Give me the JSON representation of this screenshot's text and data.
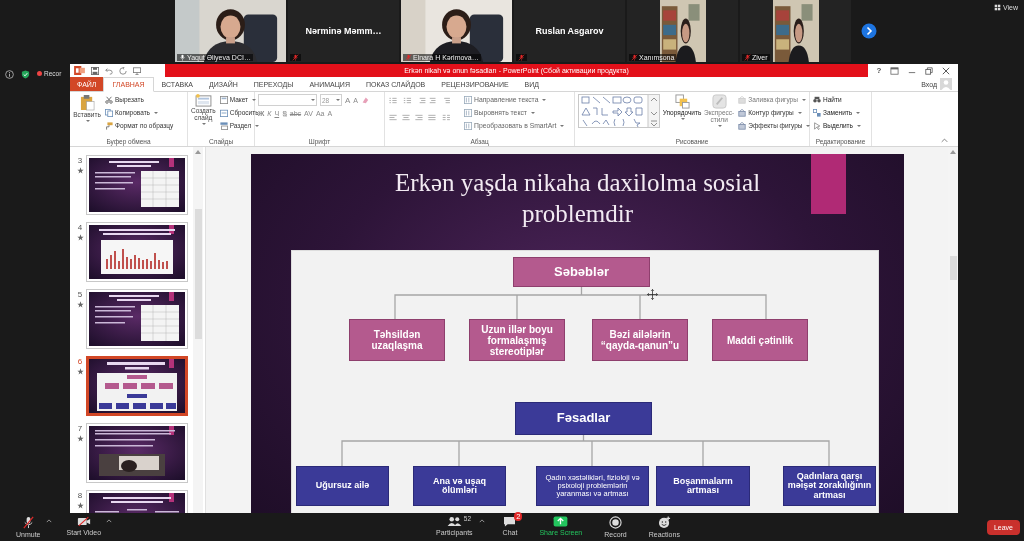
{
  "meeting": {
    "view_label": "View",
    "record_label": "Recor",
    "participants": [
      {
        "name": "Yaqut Əliyeva DCI…",
        "kind": "video",
        "muted": false
      },
      {
        "name": "Nərminə Məmm…",
        "kind": "name",
        "muted": true
      },
      {
        "name": "Elnara H Kərimova…",
        "kind": "video",
        "muted": true
      },
      {
        "name": "Ruslan Asgarov",
        "kind": "name",
        "muted": true
      },
      {
        "name": "Xanımsona",
        "kind": "portrait",
        "muted": true
      },
      {
        "name": "Ziver",
        "kind": "portrait",
        "muted": true
      }
    ]
  },
  "window": {
    "title": "Erkən nikah və onun fəsadları -  PowerPoint (Сбой активации продукта)",
    "help": "?"
  },
  "ribbon": {
    "tabs": [
      {
        "label": "ФАЙЛ",
        "kind": "file",
        "selected": false
      },
      {
        "label": "ГЛАВНАЯ",
        "kind": "tab",
        "selected": true
      },
      {
        "label": "ВСТАВКА",
        "kind": "tab",
        "selected": false
      },
      {
        "label": "ДИЗАЙН",
        "kind": "tab",
        "selected": false
      },
      {
        "label": "ПЕРЕХОДЫ",
        "kind": "tab",
        "selected": false
      },
      {
        "label": "АНИМАЦИЯ",
        "kind": "tab",
        "selected": false
      },
      {
        "label": "ПОКАЗ СЛАЙДОВ",
        "kind": "tab",
        "selected": false
      },
      {
        "label": "РЕЦЕНЗИРОВАНИЕ",
        "kind": "tab",
        "selected": false
      },
      {
        "label": "ВИД",
        "kind": "tab",
        "selected": false
      }
    ],
    "sign_in": "Вход",
    "clipboard": {
      "label": "Буфер обмена",
      "paste": "Вставить",
      "cut": "Вырезать",
      "copy": "Копировать",
      "format_painter": "Формат по образцу"
    },
    "slides": {
      "label": "Слайды",
      "new_slide": "Создать слайд",
      "layout": "Макет",
      "reset": "Сбросить",
      "section": "Раздел"
    },
    "font": {
      "label": "Шрифт",
      "size": "28",
      "size_buttons": [
        "A",
        "A"
      ],
      "buttons": [
        "Ж",
        "К",
        "Ч",
        "S",
        "abc",
        "AV",
        "Aa",
        "A"
      ]
    },
    "paragraph": {
      "label": "Абзац",
      "items": [
        "Направление текста",
        "Выровнять текст",
        "Преобразовать в SmartArt"
      ]
    },
    "drawing": {
      "label": "Рисование",
      "arrange": "Упорядочить",
      "quick_styles": "Экспресс-стили",
      "items": [
        {
          "label": "Заливка фигуры",
          "disabled": true
        },
        {
          "label": "Контур фигуры",
          "disabled": false
        },
        {
          "label": "Эффекты фигуры",
          "disabled": false
        }
      ]
    },
    "editing": {
      "label": "Редактирование",
      "items": [
        "Найти",
        "Заменить",
        "Выделить"
      ]
    }
  },
  "thumbnails": [
    {
      "number": "3",
      "kind": "table",
      "animated": true,
      "selected": false
    },
    {
      "number": "4",
      "kind": "chart",
      "animated": true,
      "selected": false
    },
    {
      "number": "5",
      "kind": "table",
      "animated": true,
      "selected": false
    },
    {
      "number": "6",
      "kind": "diagram",
      "animated": true,
      "selected": true
    },
    {
      "number": "7",
      "animated": true,
      "selected": false
    },
    {
      "number": "8",
      "kind": "columns",
      "animated": true,
      "selected": false
    }
  ],
  "slide": {
    "title": "Erkən yaşda nikaha daxilolma sosial problemdir",
    "causes_heading": "Səbəblər",
    "causes": [
      "Təhsildən uzaqlaşma",
      "Uzun illər boyu formalaşmış stereotiplər",
      "Bəzi ailələrin “qayda-qanun”u",
      "Maddi çətinlik"
    ],
    "effects_heading": "Fəsadlar",
    "effects": [
      "Uğursuz ailə",
      "Ana və uşaq ölümləri",
      "Qadın xəstəlikləri, fizioloji və psixoloji problemlərin yaranması və artması",
      "Boşanmaların artması",
      "Qadınlara qarşı məişət zorakılığının artması"
    ]
  },
  "zoom_bar": {
    "left": [
      {
        "label": "Unmute",
        "kind": "mic"
      },
      {
        "label": "Start Video",
        "kind": "camera"
      }
    ],
    "center": [
      {
        "label": "Participants",
        "kind": "participants",
        "count": "52"
      },
      {
        "label": "Chat",
        "kind": "chat",
        "badge": "2"
      },
      {
        "label": "Share Screen",
        "kind": "share"
      },
      {
        "label": "Record",
        "kind": "record"
      },
      {
        "label": "Reactions",
        "kind": "reactions"
      }
    ],
    "leave": "Leave"
  }
}
